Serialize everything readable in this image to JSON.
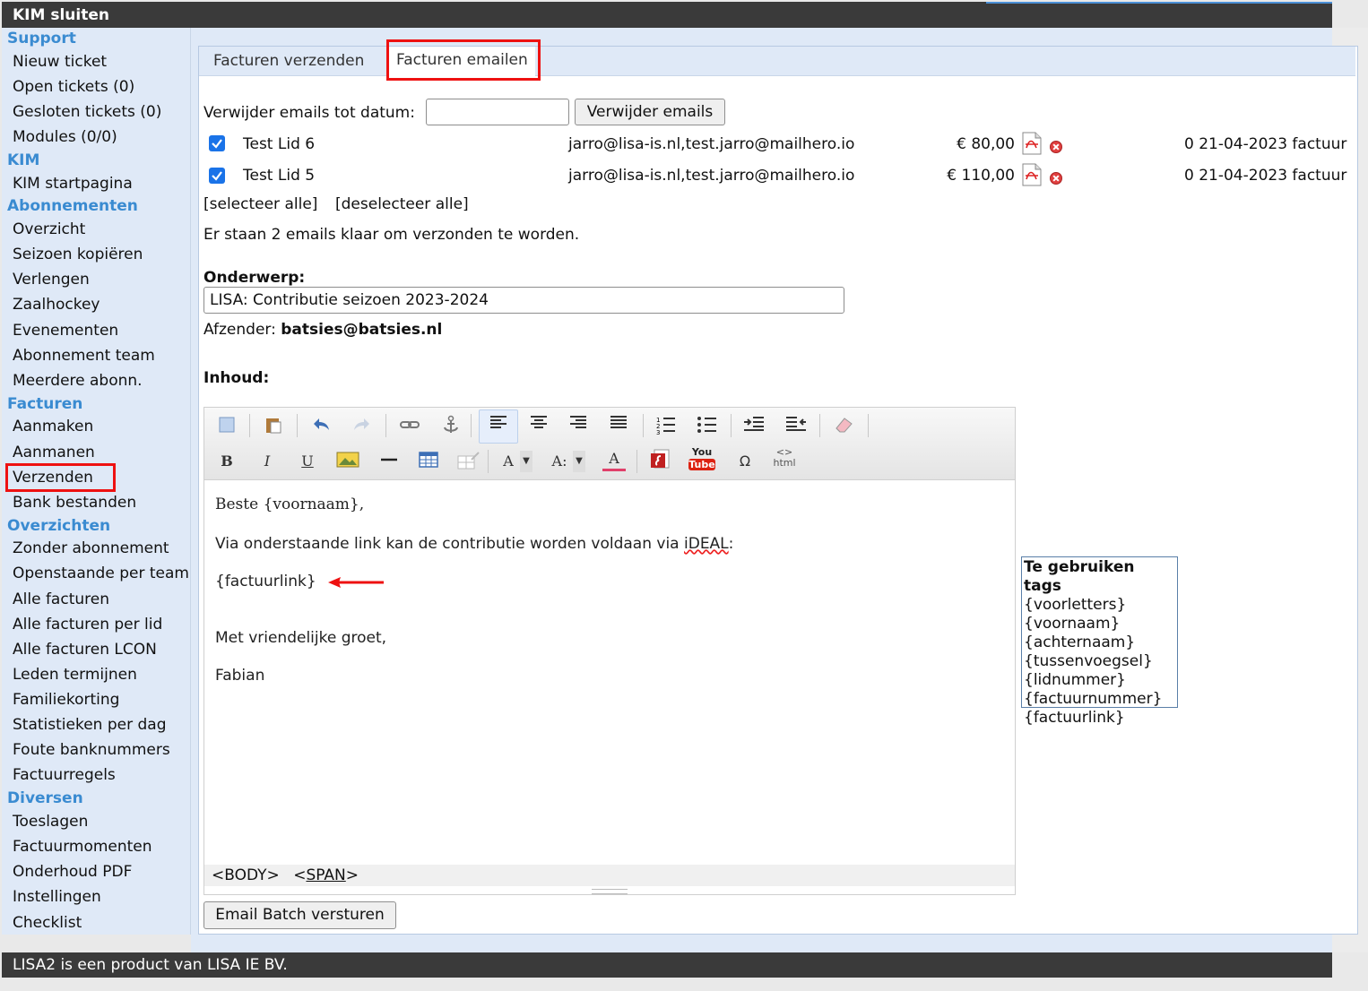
{
  "app": {
    "title": "KIM sluiten",
    "footer": "LISA2 is een product van LISA IE BV."
  },
  "sidebar": {
    "sections": [
      {
        "title": "Support",
        "items": [
          "Nieuw ticket",
          "Open tickets (0)",
          "Gesloten tickets (0)",
          "Modules (0/0)"
        ]
      },
      {
        "title": "KIM",
        "items": [
          "KIM startpagina"
        ]
      },
      {
        "title": "Abonnementen",
        "items": [
          "Overzicht",
          "Seizoen kopiëren",
          "Verlengen",
          "Zaalhockey",
          "Evenementen",
          "Abonnement team",
          "Meerdere abonn."
        ]
      },
      {
        "title": "Facturen",
        "items": [
          "Aanmaken",
          "Aanmanen",
          "Verzenden",
          "Bank bestanden"
        ]
      },
      {
        "title": "Overzichten",
        "items": [
          "Zonder abonnement",
          "Openstaande per team",
          "Alle facturen",
          "Alle facturen per lid",
          "Alle facturen LCON",
          "Leden termijnen",
          "Familiekorting",
          "Statistieken per dag",
          "Foute banknummers",
          "Factuurregels"
        ]
      },
      {
        "title": "Diversen",
        "items": [
          "Toeslagen",
          "Factuurmomenten",
          "Onderhoud PDF",
          "Instellingen",
          "Checklist"
        ]
      }
    ]
  },
  "tabs": [
    "Facturen verzenden",
    "Facturen emailen"
  ],
  "delete_emails": {
    "label": "Verwijder emails tot datum:",
    "value": "",
    "button": "Verwijder emails"
  },
  "rows": [
    {
      "checked": true,
      "name": "Test Lid 6",
      "emails": "jarro@lisa-is.nl,test.jarro@mailhero.io",
      "amount": "€ 80,00",
      "info": "0 21-04-2023 factuur"
    },
    {
      "checked": true,
      "name": "Test Lid 5",
      "emails": "jarro@lisa-is.nl,test.jarro@mailhero.io",
      "amount": "€ 110,00",
      "info": "0 21-04-2023 factuur"
    }
  ],
  "select_all": "[selecteer alle]",
  "deselect_all": "[deselecteer alle]",
  "queue_message": "Er staan 2 emails klaar om verzonden te worden.",
  "subject": {
    "label": "Onderwerp:",
    "value": "LISA: Contributie seizoen 2023-2024"
  },
  "sender": {
    "label": "Afzender:",
    "value": "batsies@batsies.nl"
  },
  "content_label": "Inhoud:",
  "editor": {
    "greeting": "Beste {voornaam},",
    "line1_pre": "Via onderstaande link kan de contributie worden voldaan via ",
    "line1_link": "iDEAL",
    "line1_post": ":",
    "link_tag": "{factuurlink}",
    "closing": "Met vriendelijke groet,",
    "signature": "Fabian",
    "status_body": "<BODY>",
    "status_span": "SPAN",
    "toolbar_font_a": "A",
    "toolbar_size": "A:",
    "toolbar_youtube_top": "You",
    "toolbar_youtube_bottom": "Tube",
    "toolbar_omega": "Ω",
    "toolbar_html": "html"
  },
  "send_button": "Email Batch versturen",
  "tags": {
    "title": "Te gebruiken tags",
    "items": [
      "{voorletters}",
      "{voornaam}",
      "{achternaam}",
      "{tussenvoegsel}",
      "{lidnummer}",
      "{factuurnummer}",
      "{factuurlink}"
    ]
  },
  "colors": {
    "accent": "#3a8bd1",
    "highlight": "#e11111",
    "titlebar": "#3a3a3a",
    "checkbox": "#1a73e8"
  }
}
